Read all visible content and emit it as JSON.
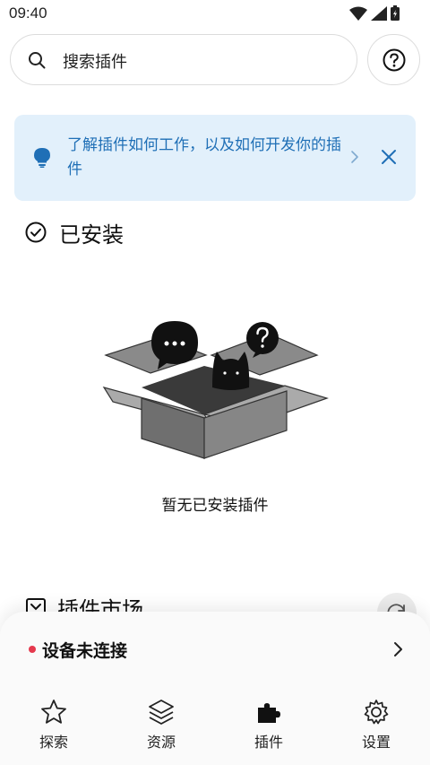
{
  "status_bar": {
    "time": "09:40"
  },
  "search": {
    "placeholder": "搜索插件"
  },
  "banner": {
    "text": "了解插件如何工作，以及如何开发你的插件"
  },
  "installed": {
    "title": "已安装",
    "empty_text": "暂无已安装插件"
  },
  "store": {
    "title": "插件市场"
  },
  "device": {
    "status": "设备未连接",
    "status_color": "#e5394d"
  },
  "nav": {
    "items": [
      {
        "label": "探索",
        "icon": "star-icon",
        "active": false
      },
      {
        "label": "资源",
        "icon": "layers-icon",
        "active": false
      },
      {
        "label": "插件",
        "icon": "puzzle-icon",
        "active": true
      },
      {
        "label": "设置",
        "icon": "gear-icon",
        "active": false
      }
    ]
  },
  "colors": {
    "accent": "#1f6fb6",
    "banner_bg": "#e2f0fb",
    "alert": "#e5394d"
  }
}
